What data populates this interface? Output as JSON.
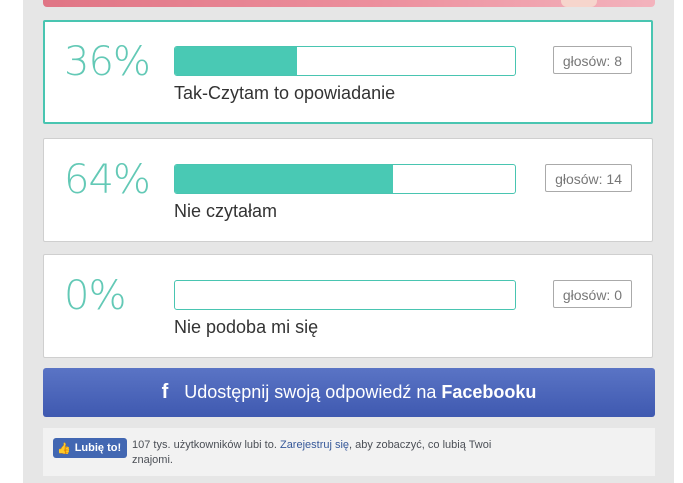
{
  "poll": {
    "options": [
      {
        "percent": "36%",
        "fill": 0.36,
        "label": "Tak-Czytam to opowiadanie",
        "votes": "głosów: 8",
        "selected": true
      },
      {
        "percent": "64%",
        "fill": 0.64,
        "label": "Nie czytałam",
        "votes": "głosów: 14",
        "selected": false
      },
      {
        "percent": "0%",
        "fill": 0.0,
        "label": "Nie podoba mi się",
        "votes": "głosów: 0",
        "selected": false
      }
    ]
  },
  "share": {
    "icon": "facebook-icon",
    "text": "Udostępnij swoją odpowiedź na",
    "brand": "Facebooku"
  },
  "like": {
    "button_label": "Lubię to!",
    "text_before": "107 tys. użytkowników lubi to.",
    "link_text": "Zarejestruj się",
    "text_after": ", aby zobaczyć, co lubią Twoi znajomi."
  },
  "colors": {
    "accent": "#49c5b1",
    "facebook": "#4267b2",
    "panel": "#e6e6e6"
  }
}
